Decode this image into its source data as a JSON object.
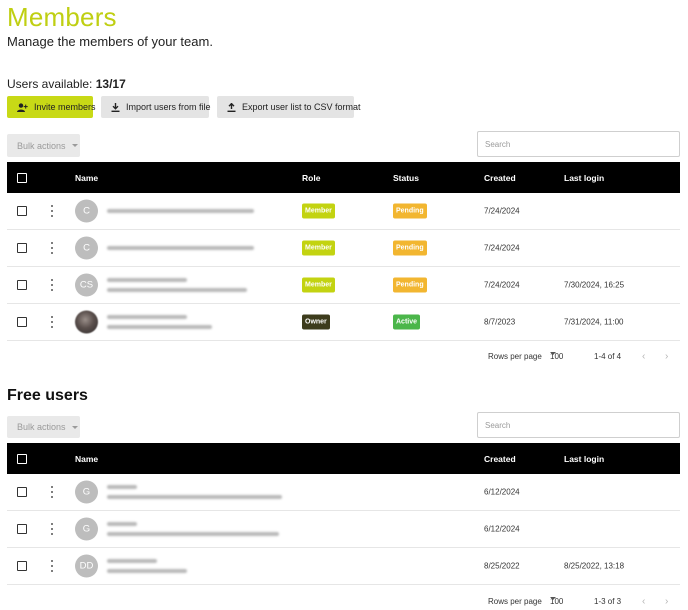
{
  "page": {
    "title": "Members",
    "subtitle": "Manage the members of your team."
  },
  "usage": {
    "label": "Users available:",
    "value": "13/17"
  },
  "toolbar": {
    "invite_label": "Invite members",
    "import_label": "Import users from file",
    "export_label": "Export user list to CSV format"
  },
  "members": {
    "bulk_actions": "Bulk actions",
    "search_placeholder": "Search",
    "columns": {
      "name": "Name",
      "role": "Role",
      "status": "Status",
      "created": "Created",
      "last_login": "Last login"
    },
    "rows": [
      {
        "initials": "C",
        "role": "Member",
        "status": "Pending",
        "created": "7/24/2024",
        "last_login": ""
      },
      {
        "initials": "C",
        "role": "Member",
        "status": "Pending",
        "created": "7/24/2024",
        "last_login": ""
      },
      {
        "initials": "CS",
        "role": "Member",
        "status": "Pending",
        "created": "7/24/2024",
        "last_login": "7/30/2024, 16:25"
      },
      {
        "initials": "",
        "role": "Owner",
        "status": "Active",
        "created": "8/7/2023",
        "last_login": "7/31/2024, 11:00"
      }
    ],
    "pagination": {
      "rows_per_page_label": "Rows per page",
      "rows_per_page": "100",
      "range": "1-4 of 4"
    }
  },
  "free_users": {
    "title": "Free users",
    "bulk_actions": "Bulk actions",
    "search_placeholder": "Search",
    "columns": {
      "name": "Name",
      "created": "Created",
      "last_login": "Last login"
    },
    "rows": [
      {
        "initials": "G",
        "created": "6/12/2024",
        "last_login": ""
      },
      {
        "initials": "G",
        "created": "6/12/2024",
        "last_login": ""
      },
      {
        "initials": "DD",
        "created": "8/25/2022",
        "last_login": "8/25/2022, 13:18"
      }
    ],
    "pagination": {
      "rows_per_page_label": "Rows per page",
      "rows_per_page": "100",
      "range": "1-3 of 3"
    }
  },
  "colors": {
    "accent": "#c8d916",
    "member_badge": "#c3d311",
    "owner_badge": "#3d3c1c",
    "pending_badge": "#f2b630",
    "active_badge": "#4bb64a",
    "header_bg": "#000000"
  },
  "icons": {
    "invite": "add-user-icon",
    "import": "download-icon",
    "export": "upload-icon",
    "bulk_caret": "caret-down-icon",
    "row_menu": "kebab-icon",
    "prev_page": "chevron-left-icon",
    "next_page": "chevron-right-icon"
  }
}
